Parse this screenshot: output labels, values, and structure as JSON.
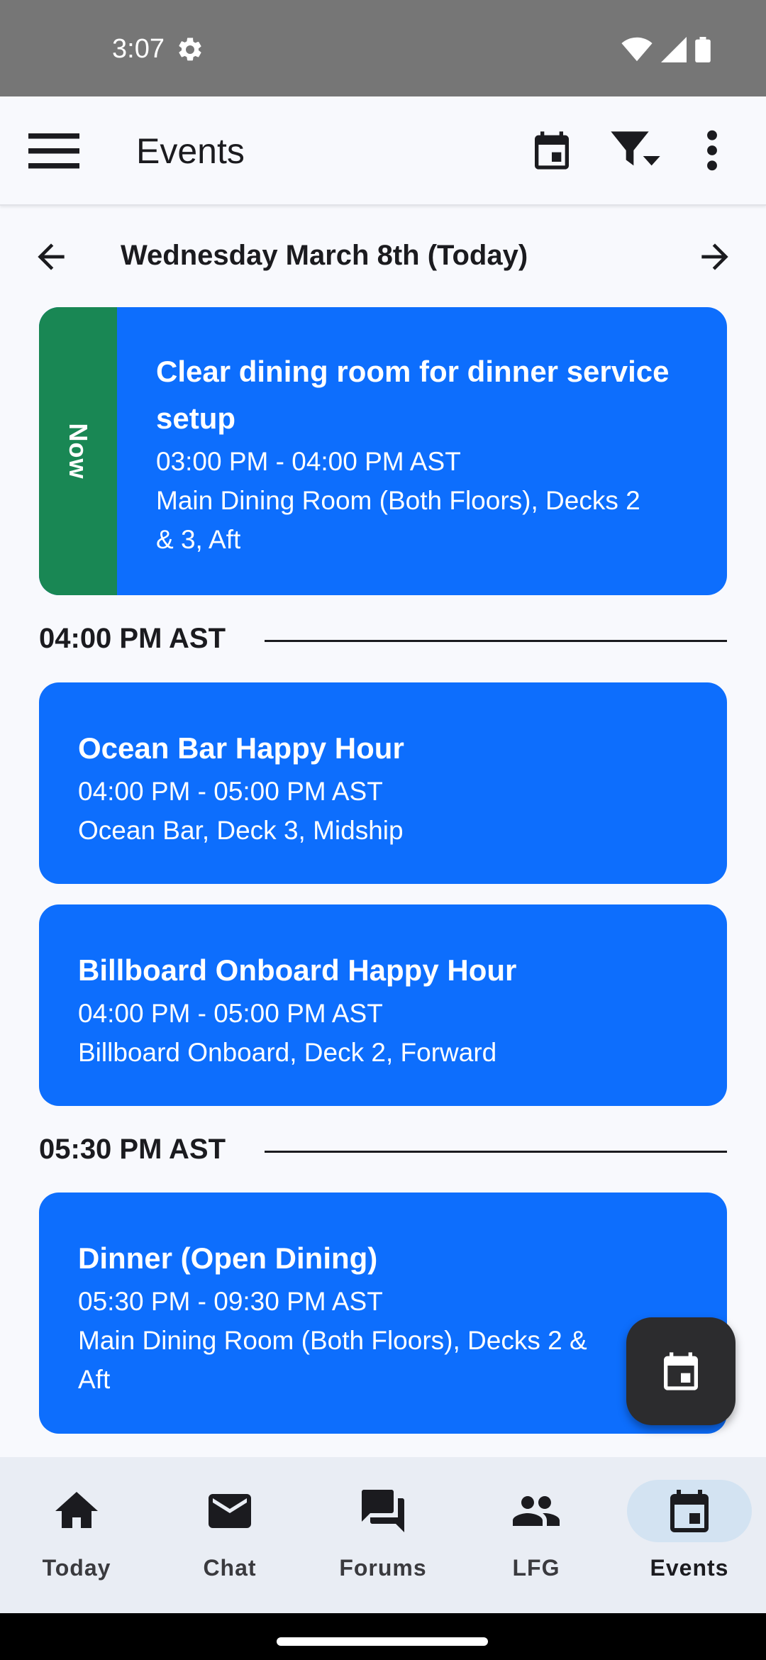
{
  "status_bar": {
    "time": "3:07"
  },
  "app_bar": {
    "title": "Events",
    "icons": [
      "menu-icon",
      "calendar-icon",
      "filter-icon",
      "more-vert-icon"
    ]
  },
  "date_nav": {
    "label": "Wednesday March 8th (Today)"
  },
  "now_event": {
    "badge": "Now",
    "title_line1": "Clear dining room for dinner service",
    "title_line2": "setup",
    "time": "03:00 PM - 04:00 PM AST",
    "location_line1": "Main Dining Room (Both Floors), Decks 2",
    "location_line2": "& 3, Aft"
  },
  "groups": [
    {
      "time_label": "04:00 PM AST",
      "events": [
        {
          "title": "Ocean Bar Happy Hour",
          "time": "04:00 PM - 05:00 PM AST",
          "location": "Ocean Bar, Deck 3, Midship"
        },
        {
          "title": "Billboard Onboard Happy Hour",
          "time": "04:00 PM - 05:00 PM AST",
          "location": "Billboard Onboard, Deck 2, Forward"
        }
      ]
    },
    {
      "time_label": "05:30 PM AST",
      "events": [
        {
          "title": "Dinner (Open Dining)",
          "time": "05:30 PM - 09:30 PM AST",
          "location_line1": "Main Dining Room (Both Floors), Decks 2 &",
          "location_line2": "Aft"
        }
      ]
    }
  ],
  "bottom_nav": {
    "items": [
      {
        "label": "Today",
        "icon": "home-icon"
      },
      {
        "label": "Chat",
        "icon": "mail-icon"
      },
      {
        "label": "Forums",
        "icon": "forum-icon"
      },
      {
        "label": "LFG",
        "icon": "people-icon"
      },
      {
        "label": "Events",
        "icon": "calendar-icon",
        "active": true
      }
    ]
  },
  "colors": {
    "card": "#0d6efd",
    "now_band": "#198754",
    "nav_active_pill": "#d3e3f2"
  }
}
